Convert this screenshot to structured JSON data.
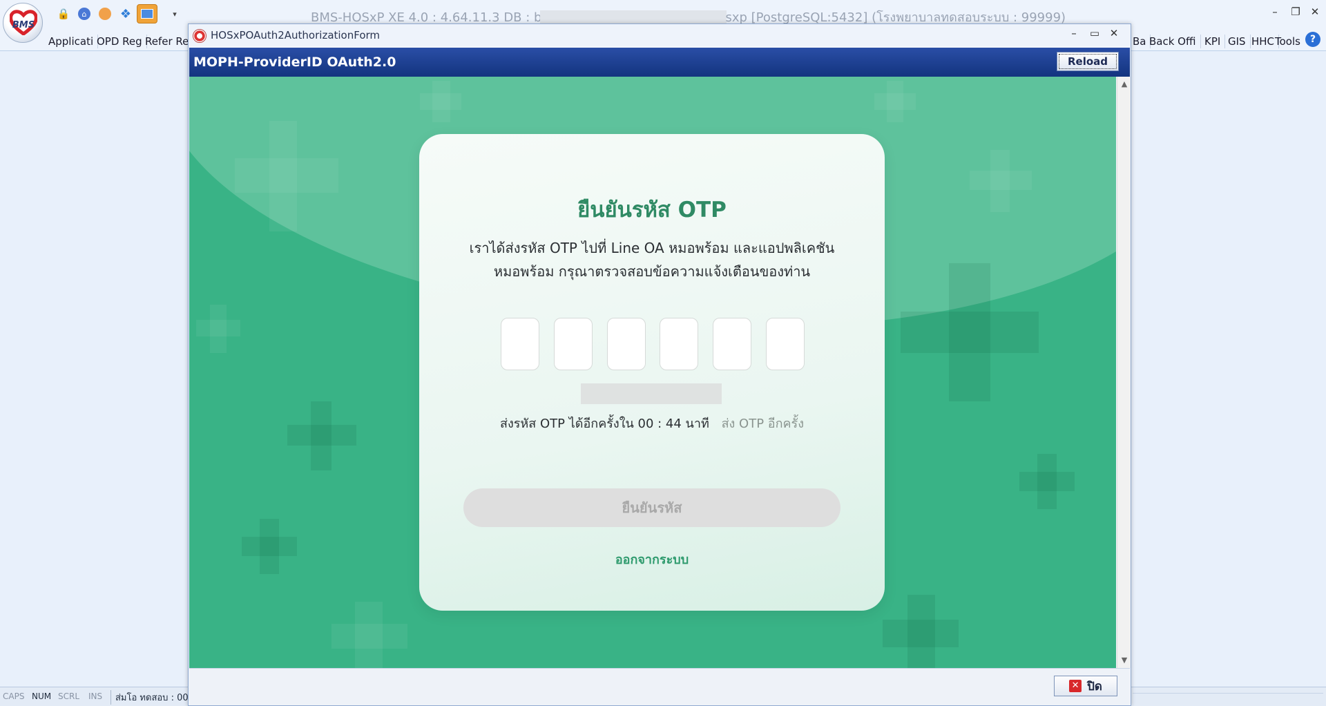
{
  "app": {
    "logo_text": "BMS",
    "title_prefix": "BMS-HOSxP XE 4.0 : 4.64.11.3 DB : b",
    "title_suffix": "sxp [PostgreSQL:5432] (โรงพยาบาลทดสอบระบบ : 99999)",
    "window_controls": {
      "minimize": "–",
      "restore": "❐",
      "close": "✕"
    }
  },
  "quick_access": {
    "lock": "🔒",
    "home": "⌂",
    "more": "▾"
  },
  "ribbon": {
    "left_tabs": [
      "Applicati",
      "OPD Reg",
      "Refer Reg"
    ],
    "right_tabs": [
      "Ba",
      "Back Offi",
      "KPI",
      "GIS",
      "HHC",
      "Tools"
    ],
    "help": "?"
  },
  "statusbar": {
    "caps": "CAPS",
    "num": "NUM",
    "scrl": "SCRL",
    "ins": "INS",
    "info": "ส่มโอ ทดสอบ : 00"
  },
  "dialog": {
    "title": "HOSxPOAuth2AuthorizationForm",
    "controls": {
      "minimize": "–",
      "maximize": "▭",
      "close": "✕"
    },
    "header_title": "MOPH-ProviderID OAuth2.0",
    "reload_label": "Reload",
    "close_label": "ปิด",
    "close_icon": "✕"
  },
  "otp_card": {
    "title": "ยืนยันรหัส OTP",
    "desc_line1": "เราได้ส่งรหัส OTP ไปที่ Line OA หมอพร้อม และแอปพลิเคชัน",
    "desc_line2": "หมอพร้อม กรุณาตรวจสอบข้อความแจ้งเตือนของท่าน",
    "digits": [
      "",
      "",
      "",
      "",
      "",
      ""
    ],
    "resend_countdown": "ส่งรหัส OTP ได้อีกครั้งใน 00 : 44 นาที",
    "resend_link": "ส่ง OTP อีกครั้ง",
    "confirm_label": "ยืนยันรหัส",
    "logout_label": "ออกจากระบบ"
  },
  "scrollbar": {
    "up": "▲",
    "down": "▼"
  }
}
